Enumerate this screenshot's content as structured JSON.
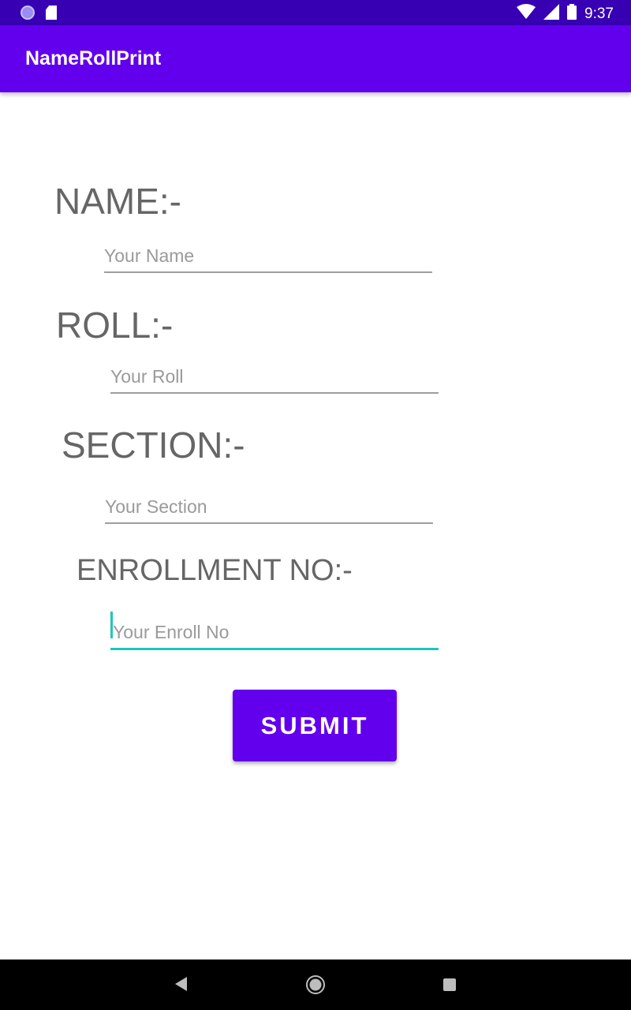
{
  "status_bar": {
    "time": "9:37",
    "icons": [
      "notification-dot-icon",
      "sd-card-icon",
      "wifi-icon",
      "signal-icon",
      "battery-icon"
    ]
  },
  "app_bar": {
    "title": "NameRollPrint"
  },
  "form": {
    "name_label": "NAME:-",
    "name_placeholder": "Your Name",
    "roll_label": "ROLL:-",
    "roll_placeholder": "Your Roll",
    "section_label": "SECTION:-",
    "section_placeholder": "Your Section",
    "enroll_label": "ENROLLMENT NO:-",
    "enroll_placeholder": "Your Enroll No",
    "submit_label": "SUBMIT"
  },
  "colors": {
    "status_bar": "#3700b3",
    "primary": "#6200ee",
    "accent": "#1ec6be",
    "label_text": "#666666"
  },
  "nav_bar": {
    "icons": [
      "back-icon",
      "home-icon",
      "recents-icon"
    ]
  }
}
